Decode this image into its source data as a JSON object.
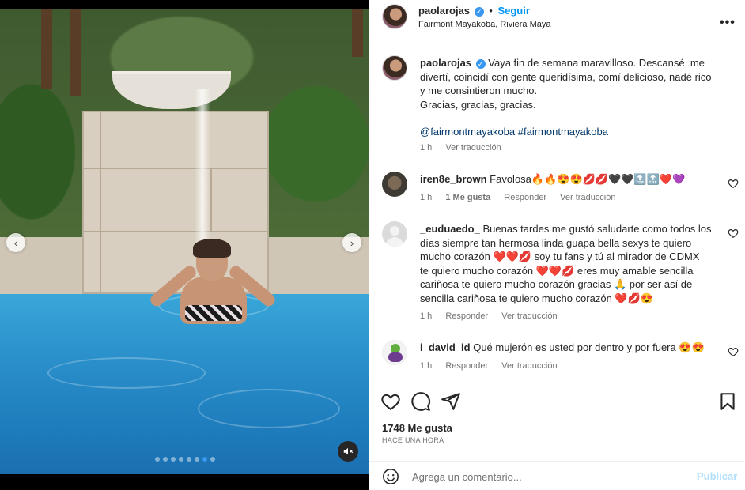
{
  "post": {
    "author": "paolarojas",
    "follow_label": "Seguir",
    "location": "Fairmont Mayakoba, Riviera Maya",
    "caption_lines": [
      "Vaya fin de semana maravilloso. Descansé, me",
      "divertí, coincidí con gente queridísima, comí delicioso, nadé rico",
      "y me consintieron mucho.",
      "Gracias, gracias, gracias."
    ],
    "caption_mention": "@fairmontmayakoba",
    "caption_hashtag": "#fairmontmayakoba",
    "caption_time": "1 h",
    "caption_translate": "Ver traducción",
    "more_label": "•••"
  },
  "media": {
    "carousel_total": 8,
    "carousel_active": 7,
    "prev_glyph": "‹",
    "next_glyph": "›"
  },
  "comments": [
    {
      "user": "iren8e_brown",
      "lines": [
        "Favolosa🔥🔥😍😍💋💋🖤🖤🔝🔝❤️💜"
      ],
      "time": "1 h",
      "likes": "1 Me gusta",
      "reply": "Responder",
      "translate": "Ver traducción"
    },
    {
      "user": "_euduaedo_",
      "lines": [
        "Buenas tardes me gustó saludarte como todos los",
        "días siempre tan hermosa linda guapa bella sexys te quiero",
        "mucho corazón ❤️❤️💋 soy tu fans y tú al mirador de CDMX",
        "te quiero mucho corazón ❤️❤️💋 eres muy amable sencilla",
        "cariñosa te quiero mucho corazón gracias 🙏 por ser así de",
        "sencilla cariñosa te quiero mucho corazón ❤️💋😍"
      ],
      "time": "1 h",
      "reply": "Responder",
      "translate": "Ver traducción"
    },
    {
      "user": "i_david_id",
      "lines": [
        "Qué mujerón es usted por dentro y por fuera 😍😍"
      ],
      "time": "1 h",
      "reply": "Responder",
      "translate": "Ver traducción"
    }
  ],
  "stats": {
    "likes": "1748 Me gusta",
    "posted": "HACE UNA HORA"
  },
  "composer": {
    "placeholder": "Agrega un comentario...",
    "post_label": "Publicar"
  }
}
